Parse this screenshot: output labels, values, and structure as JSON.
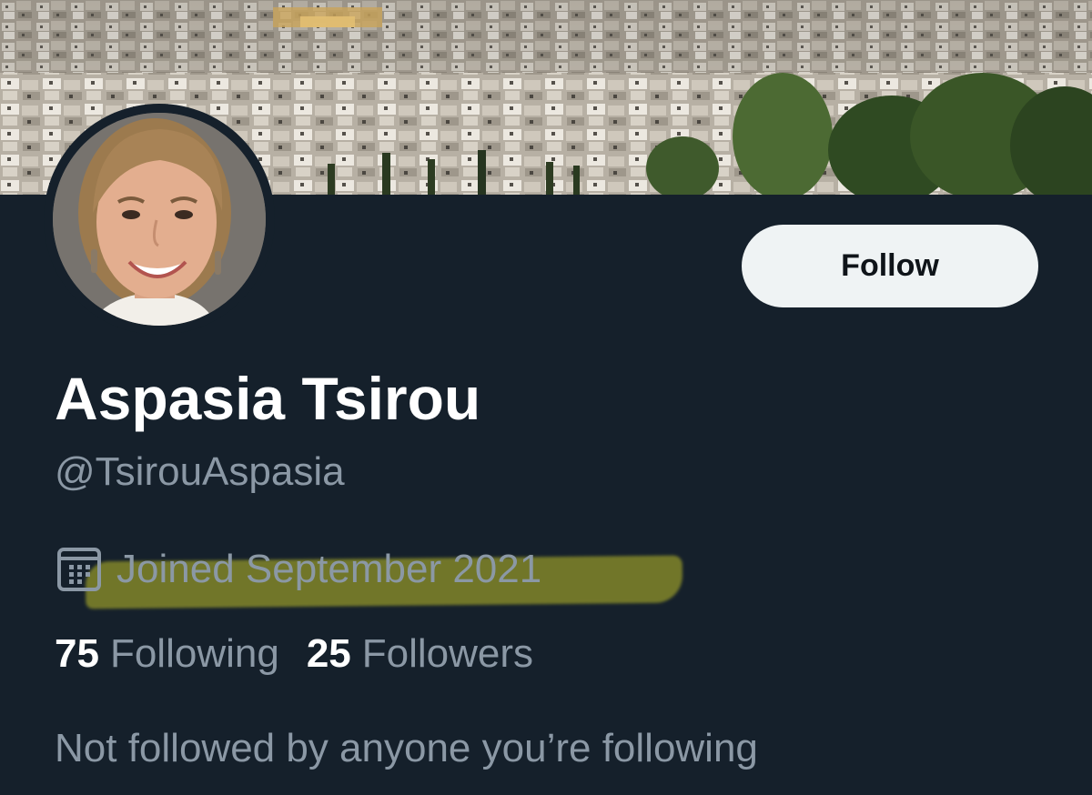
{
  "profile": {
    "display_name": "Aspasia Tsirou",
    "handle": "@TsirouAspasia",
    "joined": "Joined September 2021",
    "following_count": "75",
    "following_label": "Following",
    "followers_count": "25",
    "followers_label": "Followers",
    "mutuals_note": "Not followed by anyone you’re following"
  },
  "actions": {
    "follow_label": "Follow"
  },
  "icons": {
    "joined": "calendar-icon"
  },
  "colors": {
    "background": "#15202b",
    "primary_text": "#ffffff",
    "secondary_text": "#8b98a5",
    "follow_button_bg": "#eff3f4",
    "highlight": "#bebe28"
  }
}
